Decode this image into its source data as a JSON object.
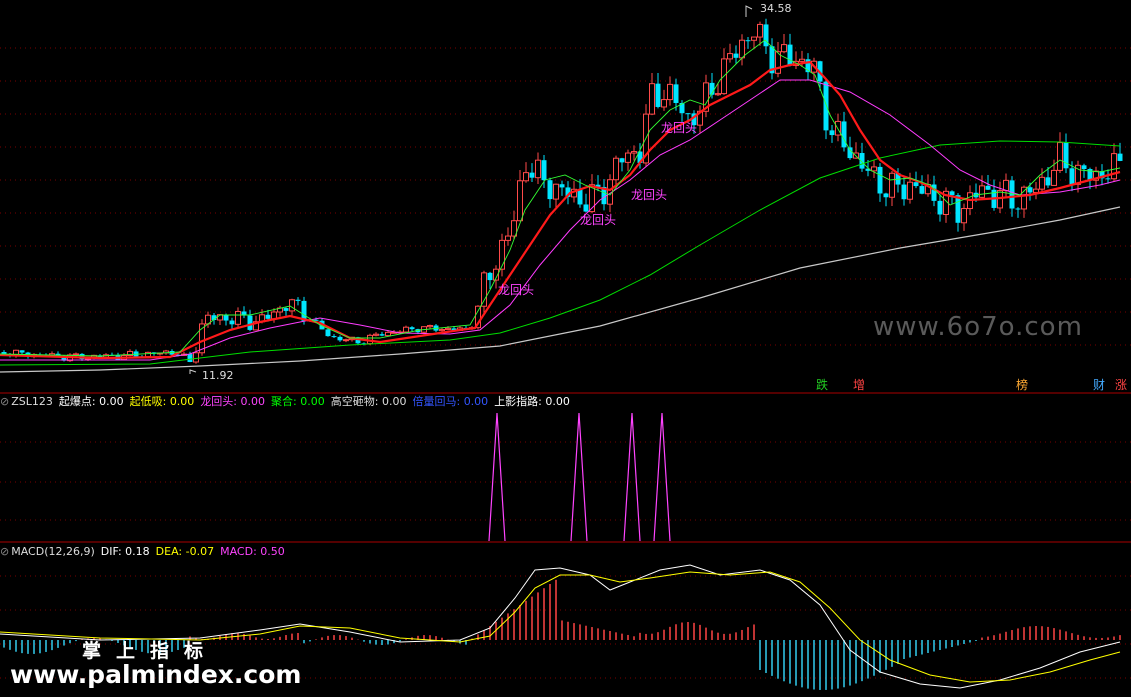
{
  "main_chart": {
    "high_label": "34.58",
    "low_label": "11.92",
    "signal_label": "龙回头",
    "watermark": "www.6o7o.com",
    "tags": [
      {
        "text": "跌",
        "color": "#22cc22"
      },
      {
        "text": "增",
        "color": "#ff4444"
      },
      {
        "text": "榜",
        "color": "#ffaa33"
      },
      {
        "text": "财",
        "color": "#44aaff"
      },
      {
        "text": "涨",
        "color": "#ff4444"
      }
    ]
  },
  "indicator": {
    "name": "ZSL123",
    "items": [
      {
        "label": "起爆点:",
        "value": "0.00",
        "color": "#ffffff"
      },
      {
        "label": "起低吸:",
        "value": "0.00",
        "color": "#ffff00"
      },
      {
        "label": "龙回头:",
        "value": "0.00",
        "color": "#ff44ff"
      },
      {
        "label": "聚合:",
        "value": "0.00",
        "color": "#00ff00"
      },
      {
        "label": "高空砸物:",
        "value": "0.00",
        "color": "#dddddd"
      },
      {
        "label": "倍量回马:",
        "value": "0.00",
        "color": "#3355ff"
      },
      {
        "label": "上影指路:",
        "value": "0.00",
        "color": "#ffffff"
      }
    ]
  },
  "macd": {
    "name": "MACD(12,26,9)",
    "dif_label": "DIF:",
    "dif_value": "0.18",
    "dea_label": "DEA:",
    "dea_value": "-0.07",
    "macd_label": "MACD:",
    "macd_value": "0.50"
  },
  "watermarks": {
    "cn": "掌上指标",
    "url": "www.palmindex.com"
  },
  "colors": {
    "up": "#ff4a4a",
    "down": "#00e5ff",
    "ma_fast": "#ffffff",
    "ma_red": "#ff1a1a",
    "ma_mag": "#ff3cff",
    "ma_green": "#00dd00",
    "ma_gray": "#c8c8c8",
    "dif": "#ffffff",
    "dea": "#ffff00",
    "signal": "#ff44ff",
    "divider": "#cc0000"
  }
}
